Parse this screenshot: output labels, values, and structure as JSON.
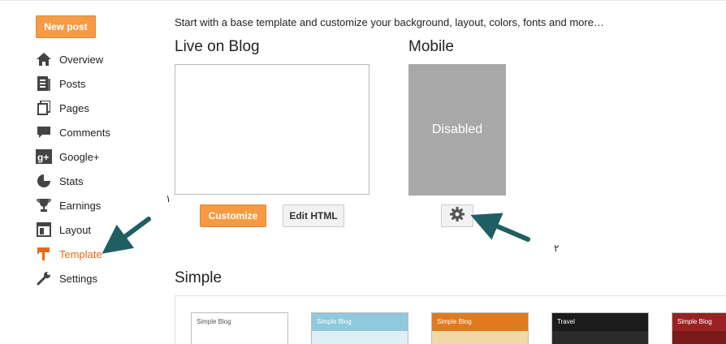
{
  "sidebar": {
    "new_post_label": "New post",
    "items": [
      {
        "label": "Overview",
        "icon": "home-icon"
      },
      {
        "label": "Posts",
        "icon": "posts-icon"
      },
      {
        "label": "Pages",
        "icon": "pages-icon"
      },
      {
        "label": "Comments",
        "icon": "comments-icon"
      },
      {
        "label": "Google+",
        "icon": "google-plus-icon"
      },
      {
        "label": "Stats",
        "icon": "stats-icon"
      },
      {
        "label": "Earnings",
        "icon": "trophy-icon"
      },
      {
        "label": "Layout",
        "icon": "layout-icon"
      },
      {
        "label": "Template",
        "icon": "template-icon",
        "active": true
      },
      {
        "label": "Settings",
        "icon": "wrench-icon"
      }
    ],
    "active_color": "#e66a16"
  },
  "main": {
    "intro": "Start with a base template and customize your background, layout, colors, fonts and more…",
    "live_heading": "Live on Blog",
    "mobile_heading": "Mobile",
    "mobile_status": "Disabled",
    "customize_label": "Customize",
    "edit_html_label": "Edit HTML",
    "marker_1": "١",
    "marker_2": "٢",
    "simple_heading": "Simple",
    "thumbnails": [
      {
        "title": "Simple Blog",
        "bg": "#ffffff",
        "header": "#ffffff",
        "text": "#555555"
      },
      {
        "title": "Simple Blog",
        "bg": "#dff0f5",
        "header": "#8fc9dc",
        "text": "#ffffff"
      },
      {
        "title": "Simple Blog",
        "bg": "#f0d9a6",
        "header": "#e07a1f",
        "text": "#ffffff"
      },
      {
        "title": "Travel",
        "bg": "#2a2a2a",
        "header": "#1b1b1b",
        "text": "#ffffff"
      },
      {
        "title": "Simple Blog",
        "bg": "#7a1a1a",
        "header": "#9a2222",
        "text": "#ffffff"
      }
    ]
  },
  "colors": {
    "accent": "#f69b43",
    "arrow": "#1f5f63",
    "disabled_box": "#a8a8a8"
  }
}
